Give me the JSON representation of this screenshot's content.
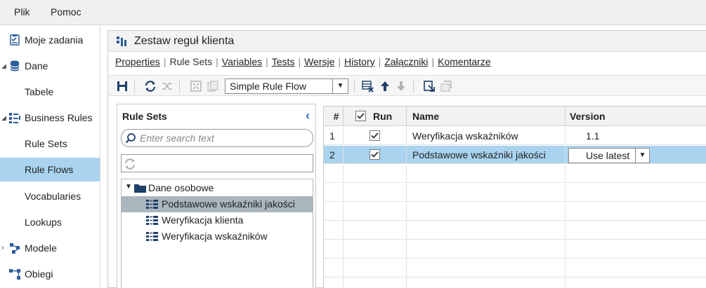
{
  "menubar": {
    "file": "Plik",
    "help": "Pomoc"
  },
  "sidebar": {
    "items": [
      {
        "label": "Moje zadania",
        "icon": "tasks-icon"
      },
      {
        "label": "Dane",
        "icon": "database-icon",
        "expanded": true
      },
      {
        "label": "Tabele"
      },
      {
        "label": "Business Rules",
        "icon": "business-rules-icon",
        "expanded": true
      },
      {
        "label": "Rule Sets"
      },
      {
        "label": "Rule Flows",
        "selected": true
      },
      {
        "label": "Vocabularies"
      },
      {
        "label": "Lookups"
      },
      {
        "label": "Modele",
        "icon": "models-icon",
        "expanded": false
      },
      {
        "label": "Obiegi",
        "icon": "workflow-icon"
      }
    ]
  },
  "main": {
    "title": "Zestaw reguł klienta",
    "tabs": [
      "Properties",
      "Rule Sets",
      "Variables",
      "Tests",
      "Wersje",
      "History",
      "Załączniki",
      "Komentarze"
    ],
    "active_tab": "Rule Sets",
    "toolbar": {
      "flow_type": "Simple Rule Flow"
    }
  },
  "rule_sets_panel": {
    "title": "Rule Sets",
    "search_placeholder": "Enter search text",
    "tree": {
      "folder": "Dane osobowe",
      "items": [
        "Podstawowe wskaźniki jakości",
        "Weryfikacja klienta",
        "Weryfikacja wskaźników"
      ],
      "selected": "Podstawowe wskaźniki jakości"
    }
  },
  "grid": {
    "columns": {
      "num": "#",
      "run": "Run",
      "name": "Name",
      "version": "Version"
    },
    "rows": [
      {
        "num": "1",
        "run": true,
        "name": "Weryfikacja wskaźników",
        "version": "1.1"
      },
      {
        "num": "2",
        "run": true,
        "name": "Podstawowe wskaźniki jakości",
        "version": "Use latest",
        "selected": true
      }
    ]
  },
  "colors": {
    "selection": "#a9d3ef",
    "tree_selection": "#aab6bd",
    "accent": "#2a6ebb"
  }
}
